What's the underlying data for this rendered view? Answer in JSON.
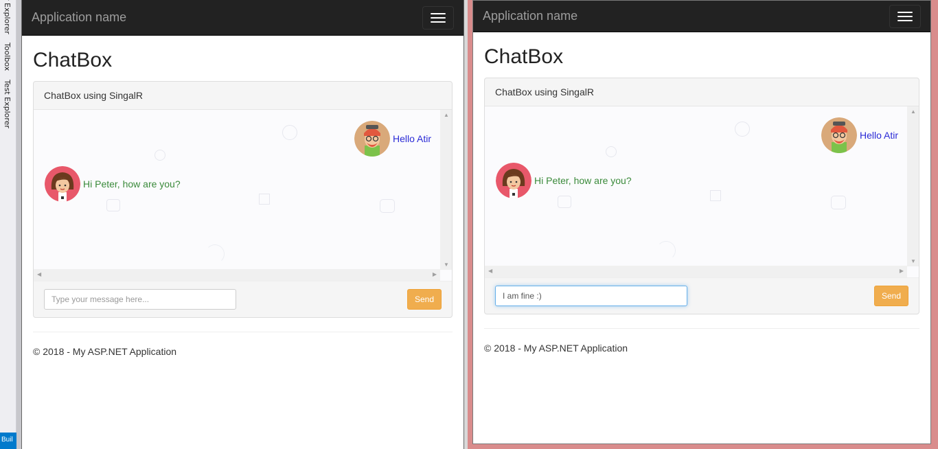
{
  "vs_side": {
    "tabs": [
      "r Explorer",
      "Toolbox",
      "Test Explorer"
    ],
    "status_label": "Buil"
  },
  "left_window": {
    "navbar": {
      "brand": "Application name",
      "toggle_icon": "hamburger-icon"
    },
    "title": "ChatBox",
    "panel": {
      "heading": "ChatBox using SingalR",
      "messages": [
        {
          "side": "right",
          "avatar": "man-avatar-icon",
          "text": "Hello Atir"
        },
        {
          "side": "left",
          "avatar": "woman-avatar-icon",
          "text": "Hi Peter, how are you?"
        }
      ],
      "input": {
        "value": "",
        "placeholder": "Type your message here..."
      },
      "send_label": "Send"
    },
    "footer": "© 2018 - My ASP.NET Application"
  },
  "right_window": {
    "navbar": {
      "brand": "Application name",
      "toggle_icon": "hamburger-icon"
    },
    "title": "ChatBox",
    "panel": {
      "heading": "ChatBox using SingalR",
      "messages": [
        {
          "side": "right",
          "avatar": "man-avatar-icon",
          "text": "Hello Atir"
        },
        {
          "side": "left",
          "avatar": "woman-avatar-icon",
          "text": "Hi Peter, how are you?"
        }
      ],
      "input": {
        "value": "I am fine :)",
        "placeholder": "Type your message here..."
      },
      "send_label": "Send"
    },
    "footer": "© 2018 - My ASP.NET Application"
  },
  "colors": {
    "navbar": "#222222",
    "send_button": "#f0ad4e",
    "sender_text": "#2a2ad6",
    "receiver_text": "#3a8a3a",
    "active_window_border": "#d98c8c"
  }
}
